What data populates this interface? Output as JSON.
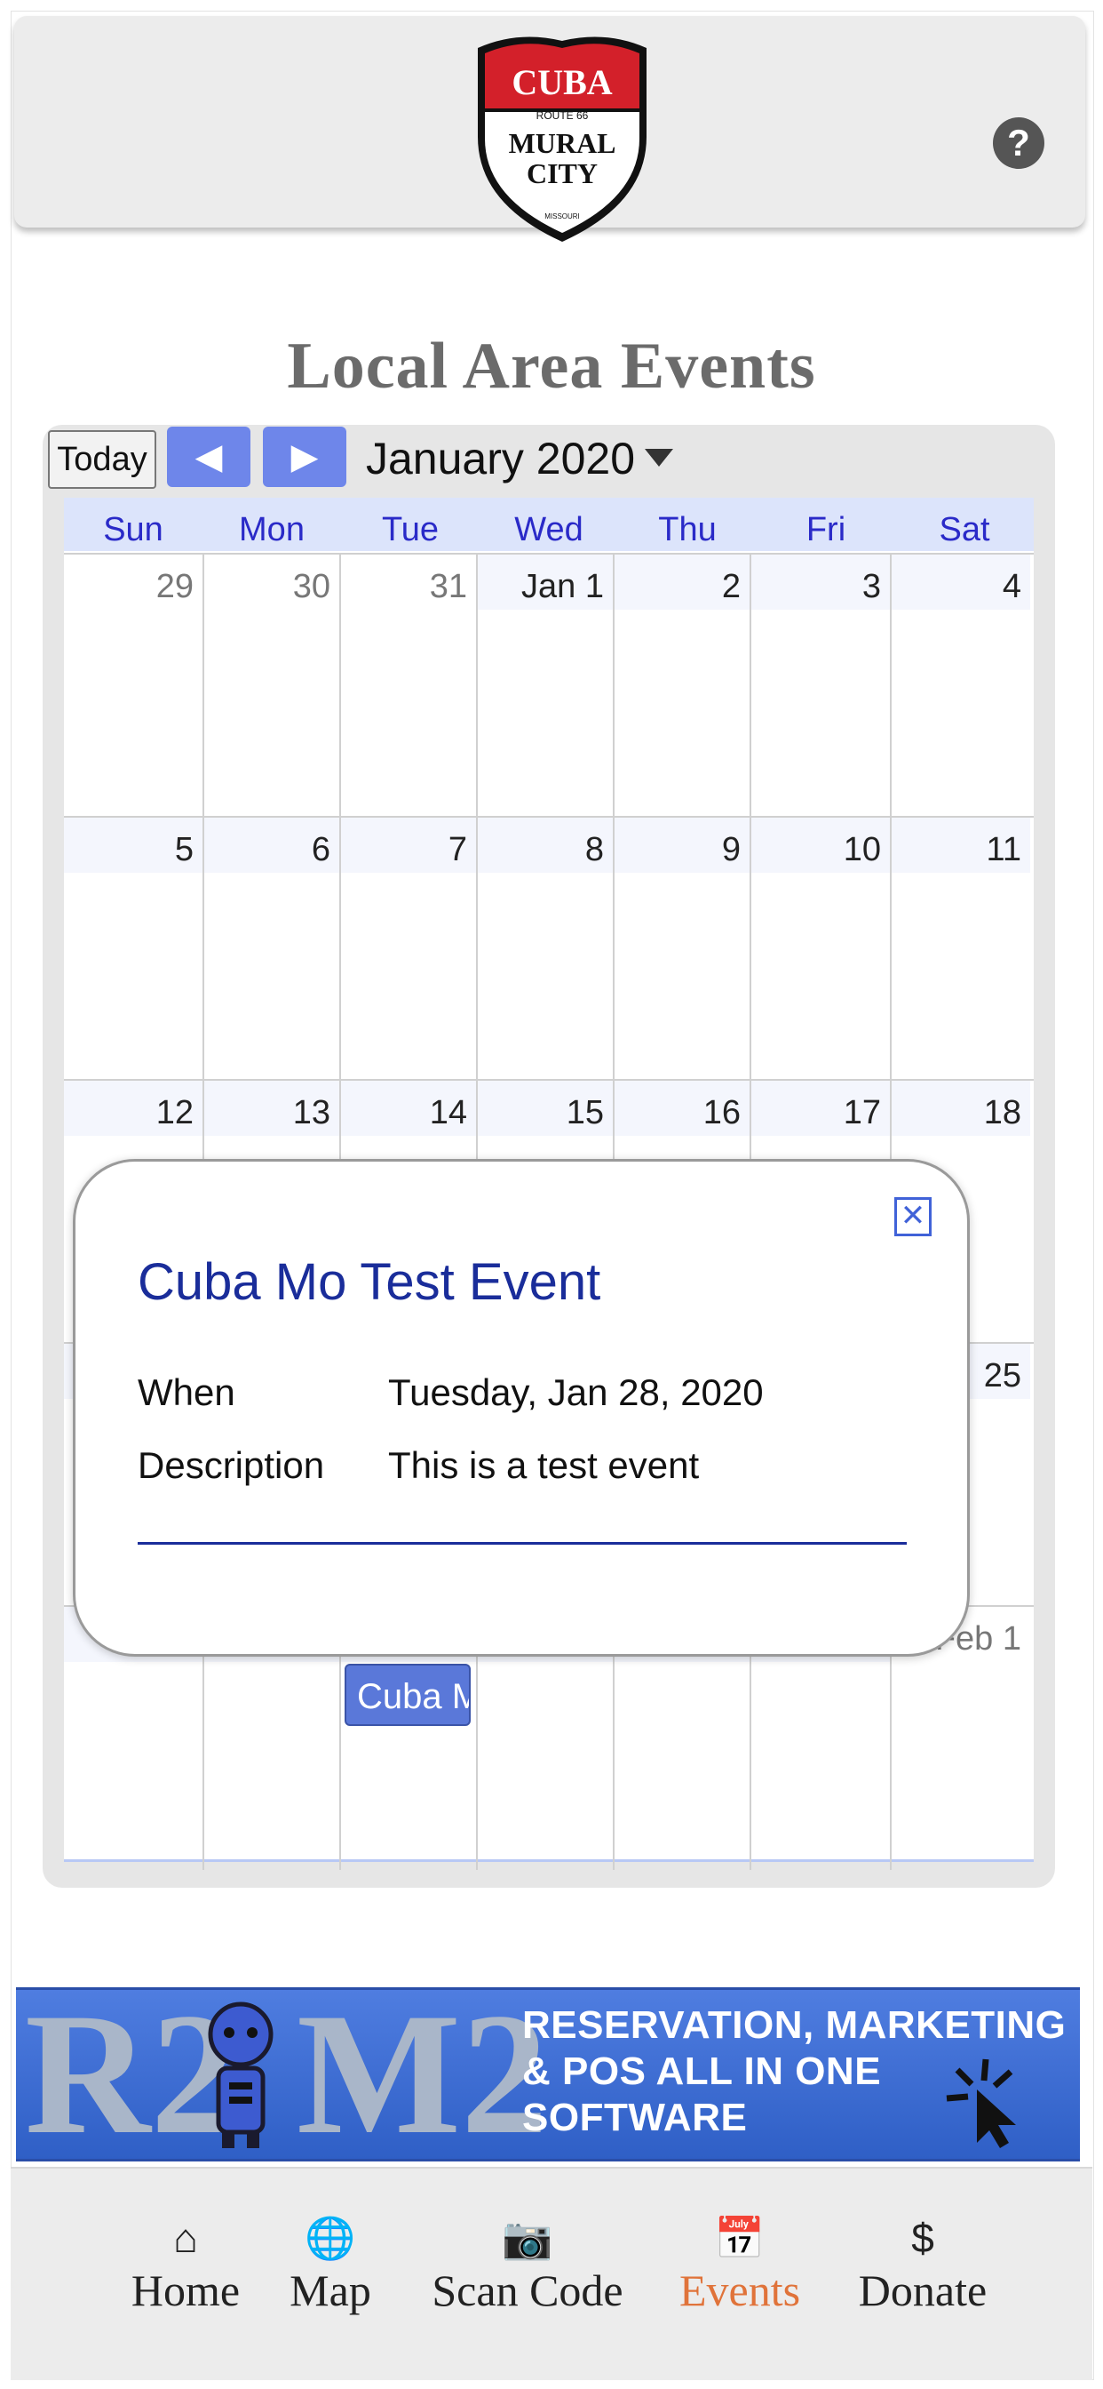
{
  "header": {
    "logo": {
      "top": "CUBA",
      "middle": "ROUTE 66",
      "bottom_line1": "MURAL",
      "bottom_line2": "CITY",
      "footer": "MISSOURI"
    },
    "help_icon": "question-circle-icon",
    "help_label": "?"
  },
  "page": {
    "title": "Local Area Events"
  },
  "calendar": {
    "today_label": "Today",
    "prev_icon": "chevron-left-icon",
    "prev_glyph": "◀",
    "next_icon": "chevron-right-icon",
    "next_glyph": "▶",
    "month_label": "January 2020",
    "dropdown_icon": "caret-down-icon",
    "weekdays": [
      "Sun",
      "Mon",
      "Tue",
      "Wed",
      "Thu",
      "Fri",
      "Sat"
    ],
    "weeks": [
      [
        "29",
        "30",
        "31",
        "Jan 1",
        "2",
        "3",
        "4"
      ],
      [
        "5",
        "6",
        "7",
        "8",
        "9",
        "10",
        "11"
      ],
      [
        "12",
        "13",
        "14",
        "15",
        "16",
        "17",
        "18"
      ],
      [
        "",
        "",
        "",
        "",
        "",
        "",
        "25"
      ],
      [
        "",
        "",
        "",
        "",
        "",
        "",
        "Feb 1"
      ]
    ],
    "event_chip_label": "Cuba M",
    "colors": {
      "header_bg": "#dce4fb",
      "weekday_text": "#2a2ac8",
      "nav_button": "#6e86ea",
      "event_chip": "#5a78d9"
    }
  },
  "popup": {
    "close_icon": "close-icon",
    "close_glyph": "✕",
    "title": "Cuba Mo Test Event",
    "when_label": "When",
    "when_value": "Tuesday, Jan 28, 2020",
    "description_label": "Description",
    "description_value": "This is a test event"
  },
  "banner": {
    "big_left": "R2",
    "big_right": "M2",
    "robot_icon": "robot-icon",
    "cursor_icon": "click-cursor-icon",
    "text_line1": "RESERVATION, MARKETING",
    "text_line2": "& POS ALL IN ONE",
    "text_line3": "SOFTWARE"
  },
  "bottom_nav": {
    "items": [
      {
        "label": "Home",
        "icon": "home-icon",
        "glyph": "⌂",
        "active": false
      },
      {
        "label": "Map",
        "icon": "globe-icon",
        "glyph": "🌐",
        "active": false
      },
      {
        "label": "Scan Code",
        "icon": "camera-icon",
        "glyph": "📷",
        "active": false
      },
      {
        "label": "Events",
        "icon": "calendar-icon",
        "glyph": "📅",
        "active": true
      },
      {
        "label": "Donate",
        "icon": "dollar-icon",
        "glyph": "$",
        "active": false
      }
    ],
    "colors": {
      "active": "#e0733a",
      "inactive": "#222222"
    }
  }
}
